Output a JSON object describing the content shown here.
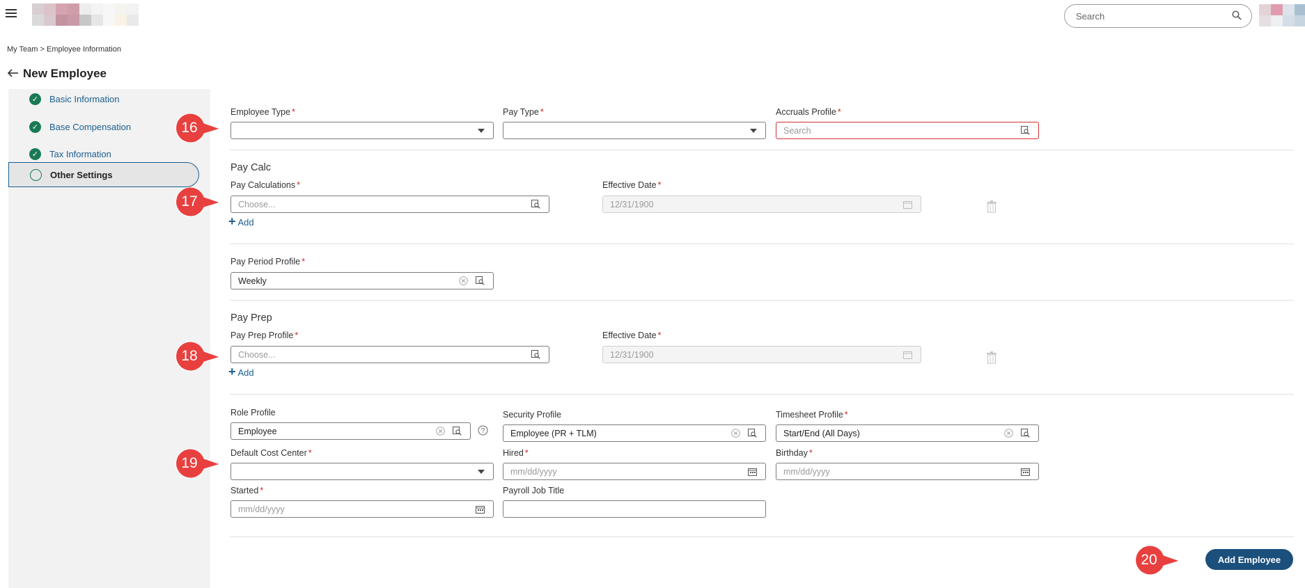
{
  "header": {
    "search_placeholder": "Search"
  },
  "breadcrumb": {
    "items": [
      "My Team",
      "Employee Information"
    ],
    "separator": ">"
  },
  "page": {
    "title": "New Employee"
  },
  "sidebar": {
    "items": [
      {
        "label": "Basic Information",
        "status": "complete"
      },
      {
        "label": "Base Compensation",
        "status": "complete"
      },
      {
        "label": "Tax Information",
        "status": "complete"
      },
      {
        "label": "Other Settings",
        "status": "current"
      }
    ]
  },
  "form": {
    "employee_type": {
      "label": "Employee Type",
      "value": ""
    },
    "pay_type": {
      "label": "Pay Type",
      "value": ""
    },
    "accruals_profile": {
      "label": "Accruals Profile",
      "placeholder": "Search"
    },
    "pay_calc": {
      "title": "Pay Calc",
      "calc_label": "Pay Calculations",
      "calc_placeholder": "Choose...",
      "date_label": "Effective Date",
      "date_value": "12/31/1900",
      "add_label": "Add"
    },
    "pay_period_profile": {
      "label": "Pay Period Profile",
      "value": "Weekly"
    },
    "pay_prep": {
      "title": "Pay Prep",
      "profile_label": "Pay Prep Profile",
      "profile_placeholder": "Choose...",
      "date_label": "Effective Date",
      "date_value": "12/31/1900",
      "add_label": "Add"
    },
    "role_profile": {
      "label": "Role Profile",
      "value": "Employee"
    },
    "security_profile": {
      "label": "Security Profile",
      "value": "Employee (PR + TLM)"
    },
    "timesheet_profile": {
      "label": "Timesheet Profile",
      "value": "Start/End (All Days)"
    },
    "default_cost_center": {
      "label": "Default Cost Center",
      "value": ""
    },
    "hired": {
      "label": "Hired",
      "placeholder": "mm/dd/yyyy"
    },
    "birthday": {
      "label": "Birthday",
      "placeholder": "mm/dd/yyyy"
    },
    "started": {
      "label": "Started",
      "placeholder": "mm/dd/yyyy"
    },
    "payroll_job_title": {
      "label": "Payroll Job Title",
      "value": ""
    },
    "submit_label": "Add Employee"
  },
  "markers": [
    "16",
    "17",
    "18",
    "19",
    "20"
  ],
  "colors": {
    "accent": "#1b4f7c",
    "link": "#1b5e8e",
    "complete": "#1a7a55",
    "required": "#c62828",
    "marker": "#e8403f"
  }
}
